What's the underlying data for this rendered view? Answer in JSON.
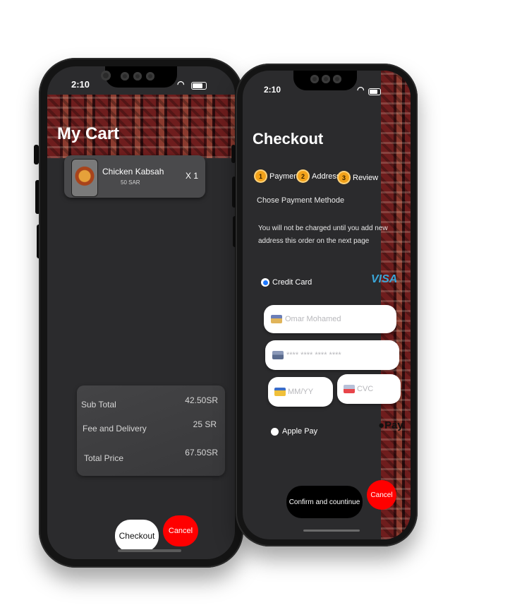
{
  "cart_screen": {
    "status_time": "2:10",
    "title": "My Cart",
    "item": {
      "name": "Chicken Kabsah",
      "price": "50 SAR",
      "quantity": "X 1"
    },
    "summary": {
      "subtotal_label": "Sub Total",
      "subtotal_value": "42.50SR",
      "fee_label": "Fee and Delivery",
      "fee_value": "25 SR",
      "total_label": "Total Price",
      "total_value": "67.50SR"
    },
    "checkout_label": "Checkout",
    "cancel_label": "Cancel"
  },
  "checkout_screen": {
    "status_time": "2:10",
    "title": "Checkout",
    "steps": [
      {
        "number": "1",
        "label": "Payment"
      },
      {
        "number": "2",
        "label": "Address"
      },
      {
        "number": "3",
        "label": "Review"
      }
    ],
    "choose_label": "Chose Payment Methode",
    "notice_line1": "You will not be charged until you add new",
    "notice_line2": "address this order on the next page",
    "credit_card_label": "Credit Card",
    "visa_label": "VISA",
    "name_placeholder": "Omar Mohamed",
    "card_placeholder": "**** **** **** ****",
    "expiry_placeholder": "MM/YY",
    "cvc_placeholder": "CVC",
    "apple_pay_label": "Apple Pay",
    "apple_pay_logo": "Pay",
    "confirm_label": "Confirm and countinue",
    "cancel_label": "Cancel"
  },
  "colors": {
    "screen_bg": "#2b2b2d",
    "cancel_red": "#ff0000",
    "step_orange": "#f2a21a",
    "radio_blue": "#1e78ff",
    "visa_blue": "#3aa6d8"
  }
}
